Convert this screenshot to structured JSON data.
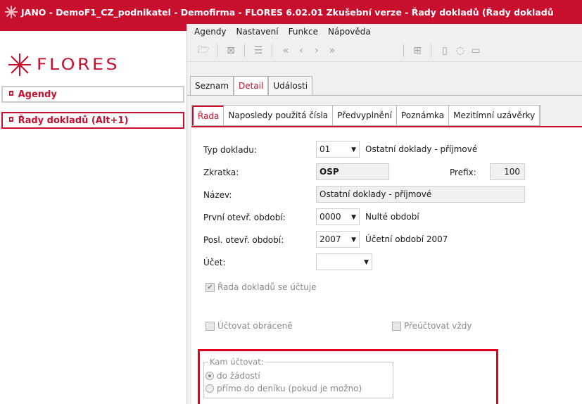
{
  "window": {
    "title": "JANO - DemoF1_CZ_podnikatel - Demofirma - FLORES 6.02.01 Zkušební verze - Řady dokladů  (Řady dokladů"
  },
  "colors": {
    "brand": "#c8102e",
    "highlight": "#e3001b"
  },
  "logo": {
    "text": "FLORES"
  },
  "sidebar": {
    "items": [
      {
        "label": "Agendy",
        "icon": "collapse-bullet-icon"
      },
      {
        "label": "Řady dokladů (Alt+1)",
        "icon": "expand-bullet-icon"
      }
    ]
  },
  "menu": {
    "items": [
      "Agendy",
      "Nastavení",
      "Funkce",
      "Nápověda"
    ]
  },
  "toolbar": {
    "icons": [
      "folder-icon",
      "delete-icon",
      "list-icon",
      "first-icon",
      "previous-icon",
      "next-icon",
      "last-icon",
      "calculator-icon",
      "help-icon",
      "chat-icon",
      "info-icon"
    ],
    "glyphs": {
      "folder": "🗁",
      "delete": "⊠",
      "list": "☰",
      "first": "«",
      "prev": "‹",
      "next": "›",
      "last": "»",
      "calc": "⊞",
      "help": "▯",
      "chat": "◌",
      "info": "▭"
    }
  },
  "tabs_top": [
    "Seznam",
    "Detail",
    "Události"
  ],
  "tabs_sub": [
    "Řada",
    "Naposledy použitá čísla",
    "Předvyplnění",
    "Poznámka",
    "Mezitímní uzávěrky"
  ],
  "form": {
    "typ_label": "Typ dokladu:",
    "typ_value": "01",
    "typ_desc": "Ostatní doklady - příjmové",
    "zkratka_label": "Zkratka:",
    "zkratka_value": "OSP",
    "prefix_label": "Prefix:",
    "prefix_value": "100",
    "nazev_label": "Název:",
    "nazev_value": "Ostatní doklady - příjmové",
    "prvni_label": "První otevř. období:",
    "prvni_value": "0000",
    "prvni_desc": "Nulté období",
    "posl_label": "Posl. otevř. období:",
    "posl_value": "2007",
    "posl_desc": "Účetní období 2007",
    "ucet_label": "Účet:",
    "ucet_value": ""
  },
  "checkboxes": {
    "rada_uctuje": {
      "label": "Řada dokladů se účtuje",
      "checked": true
    },
    "uctovat_obracene": {
      "label": "Účtovat obráceně",
      "checked": false
    },
    "preuctovat": {
      "label": "Přeúčtovat vždy",
      "checked": false
    }
  },
  "kam_uctovat": {
    "legend": "Kam účtovat:",
    "options": [
      {
        "label": "do žádostí",
        "selected": true
      },
      {
        "label": "přímo do deníku (pokud je možno)",
        "selected": false
      }
    ]
  }
}
